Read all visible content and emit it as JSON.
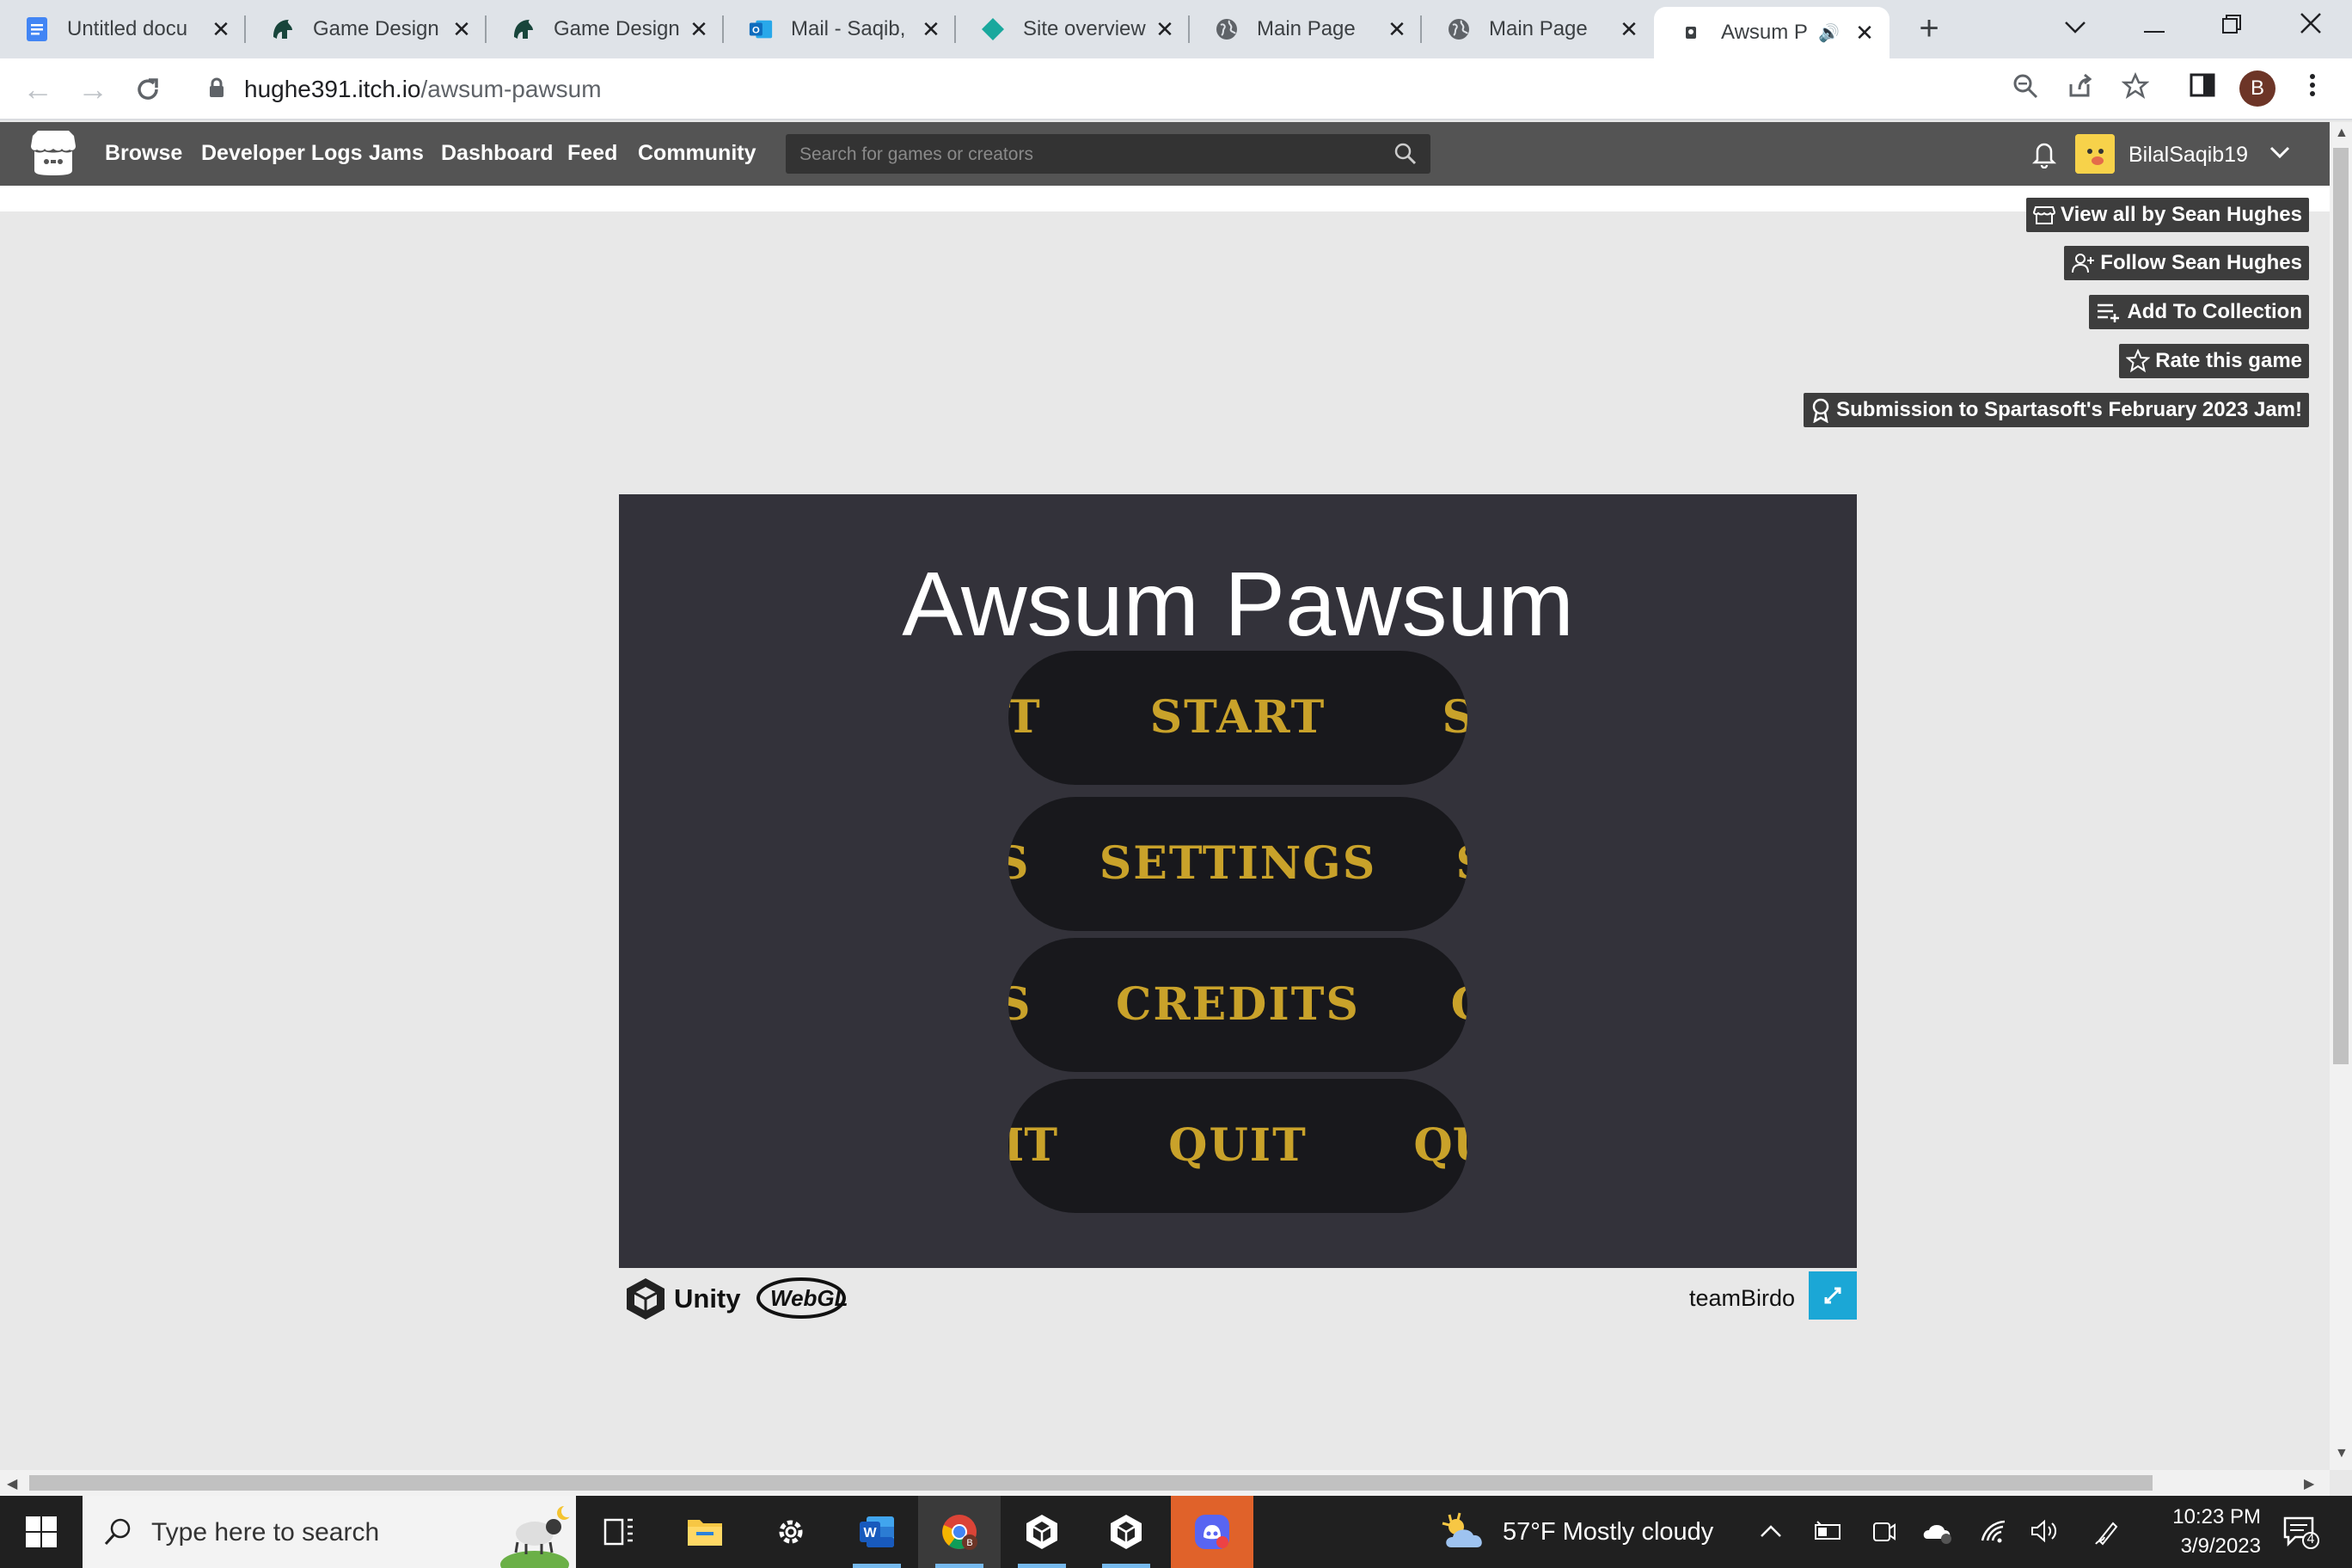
{
  "browser": {
    "tabs": [
      {
        "title": "Untitled docu",
        "icon": "google-docs-icon"
      },
      {
        "title": "Game Design",
        "icon": "spartan-icon"
      },
      {
        "title": "Game Design",
        "icon": "spartan-icon"
      },
      {
        "title": "Mail - Saqib,",
        "icon": "outlook-icon"
      },
      {
        "title": "Site overview",
        "icon": "diamond-icon"
      },
      {
        "title": "Main Page",
        "icon": "globe-icon"
      },
      {
        "title": "Main Page",
        "icon": "globe-icon"
      },
      {
        "title": "Awsum P",
        "icon": "itch-icon",
        "active": true
      }
    ],
    "new_tab": "+",
    "url_host": "hughe391.itch.io",
    "url_path": "/awsum-pawsum",
    "profile_initial": "B"
  },
  "itch_nav": {
    "links": [
      "Browse",
      "Developer Logs",
      "Jams",
      "Dashboard",
      "Feed",
      "Community"
    ],
    "search_placeholder": "Search for games or creators",
    "username": "BilalSaqib19"
  },
  "actions": {
    "view_all": "View all by Sean Hughes",
    "follow": "Follow Sean Hughes",
    "add_collection": "Add To Collection",
    "rate": "Rate this game",
    "submission": "Submission to Spartasoft's February 2023 Jam!"
  },
  "game": {
    "title": "Awsum Pawsum",
    "menu": [
      {
        "label": "START",
        "left_ghost": "T",
        "right_ghost": "S"
      },
      {
        "label": "SETTINGS",
        "left_ghost": "S",
        "right_ghost": "S"
      },
      {
        "label": "CREDITS",
        "left_ghost": "S",
        "right_ghost": "C"
      },
      {
        "label": "QUIT",
        "left_ghost": "IT",
        "right_ghost": "QU"
      }
    ],
    "engine": "Unity",
    "platform": "WebGL",
    "team": "teamBirdo",
    "accent": "#c9a22a"
  },
  "taskbar": {
    "search_placeholder": "Type here to search",
    "weather": "57°F  Mostly cloudy",
    "time": "10:23 PM",
    "date": "3/9/2023",
    "notifications": "4"
  }
}
